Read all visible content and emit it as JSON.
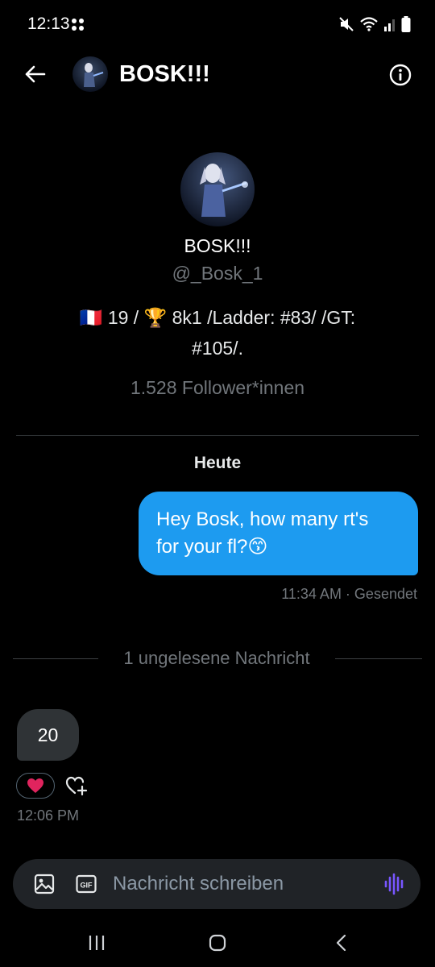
{
  "status_bar": {
    "time": "12:13",
    "icons": [
      "notification-dots-icon",
      "mute-icon",
      "wifi-icon",
      "signal-icon",
      "battery-icon"
    ]
  },
  "header": {
    "title": "BOSK!!!",
    "icons": [
      "back-arrow-icon",
      "info-icon"
    ]
  },
  "profile": {
    "name": "BOSK!!!",
    "handle": "@_Bosk_1",
    "bio_line1": "🇫🇷 19 / 🏆 8k1  /Ladder:  #83/  /GT:",
    "bio_line2": "#105/.",
    "followers": "1.528 Follower*innen"
  },
  "conversation": {
    "date_separator": "Heute",
    "sent_message": {
      "line1": "Hey Bosk, how many rt's",
      "line2": "for your fl?😙",
      "meta": "11:34 AM · Gesendet"
    },
    "unread_separator": "1 ungelesene Nachricht",
    "received_message": {
      "text": "20",
      "reaction": "❤️",
      "time": "12:06 PM"
    }
  },
  "composer": {
    "placeholder": "Nachricht schreiben",
    "gif_label": "GIF",
    "icons": [
      "image-icon",
      "gif-icon",
      "voice-icon"
    ]
  },
  "nav_bar": {
    "icons": [
      "recents-icon",
      "home-icon",
      "nav-back-icon"
    ]
  },
  "colors": {
    "background": "#000000",
    "accent_blue": "#1d9bf0",
    "received_bubble": "#2f3336",
    "secondary_text": "#71767b",
    "voice_purple": "#7856ff"
  }
}
